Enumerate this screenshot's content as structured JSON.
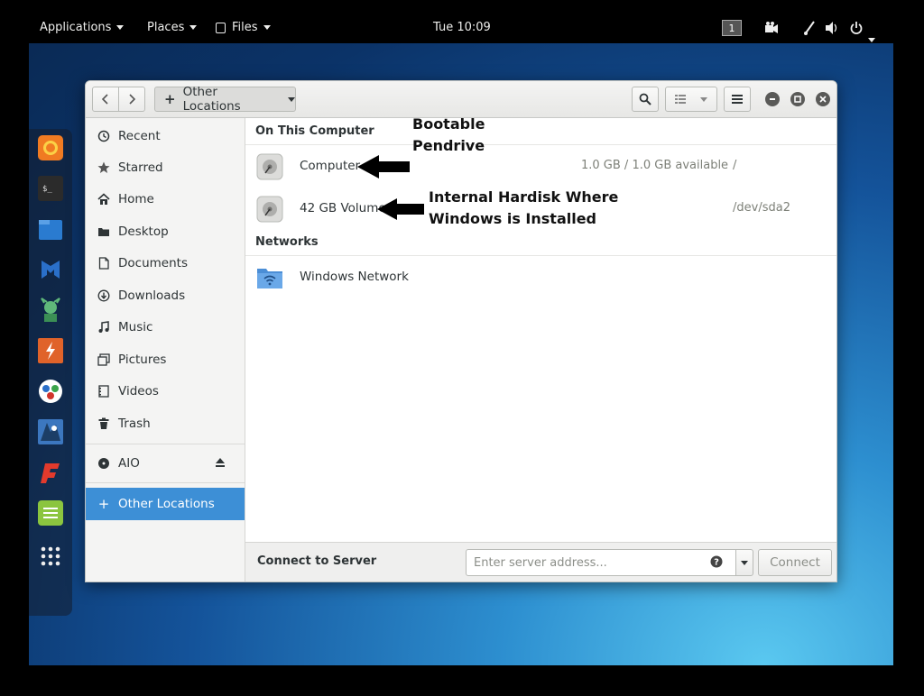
{
  "topbar": {
    "applications": "Applications",
    "places": "Places",
    "files": "Files",
    "clock": "Tue 10:09",
    "workspace": "1"
  },
  "window": {
    "location_button": "Other Locations"
  },
  "sidebar": {
    "items": [
      {
        "label": "Recent",
        "icon": "clock-icon"
      },
      {
        "label": "Starred",
        "icon": "star-icon"
      },
      {
        "label": "Home",
        "icon": "home-icon"
      },
      {
        "label": "Desktop",
        "icon": "folder-icon"
      },
      {
        "label": "Documents",
        "icon": "document-icon"
      },
      {
        "label": "Downloads",
        "icon": "download-icon"
      },
      {
        "label": "Music",
        "icon": "music-icon"
      },
      {
        "label": "Pictures",
        "icon": "picture-icon"
      },
      {
        "label": "Videos",
        "icon": "video-icon"
      },
      {
        "label": "Trash",
        "icon": "trash-icon"
      }
    ],
    "device": {
      "label": "AIO",
      "icon": "disc-icon"
    },
    "other_locations": "Other Locations"
  },
  "main": {
    "on_this_computer": "On This Computer",
    "drives": [
      {
        "name": "Computer",
        "size": "1.0 GB / 1.0 GB available",
        "path": "/"
      },
      {
        "name": "42 GB Volume",
        "size": "",
        "path": "/dev/sda2"
      }
    ],
    "networks": "Networks",
    "network_items": [
      {
        "name": "Windows Network"
      }
    ],
    "annotations": {
      "first_line1": "Bootable",
      "first_line2": "Pendrive",
      "second_line1": "Internal Hardisk Where",
      "second_line2": "Windows is Installed"
    }
  },
  "bottom": {
    "connect_label": "Connect to Server",
    "placeholder": "Enter server address...",
    "connect_button": "Connect"
  },
  "colors": {
    "selection": "#3d8fd6",
    "panel": "#000000"
  }
}
